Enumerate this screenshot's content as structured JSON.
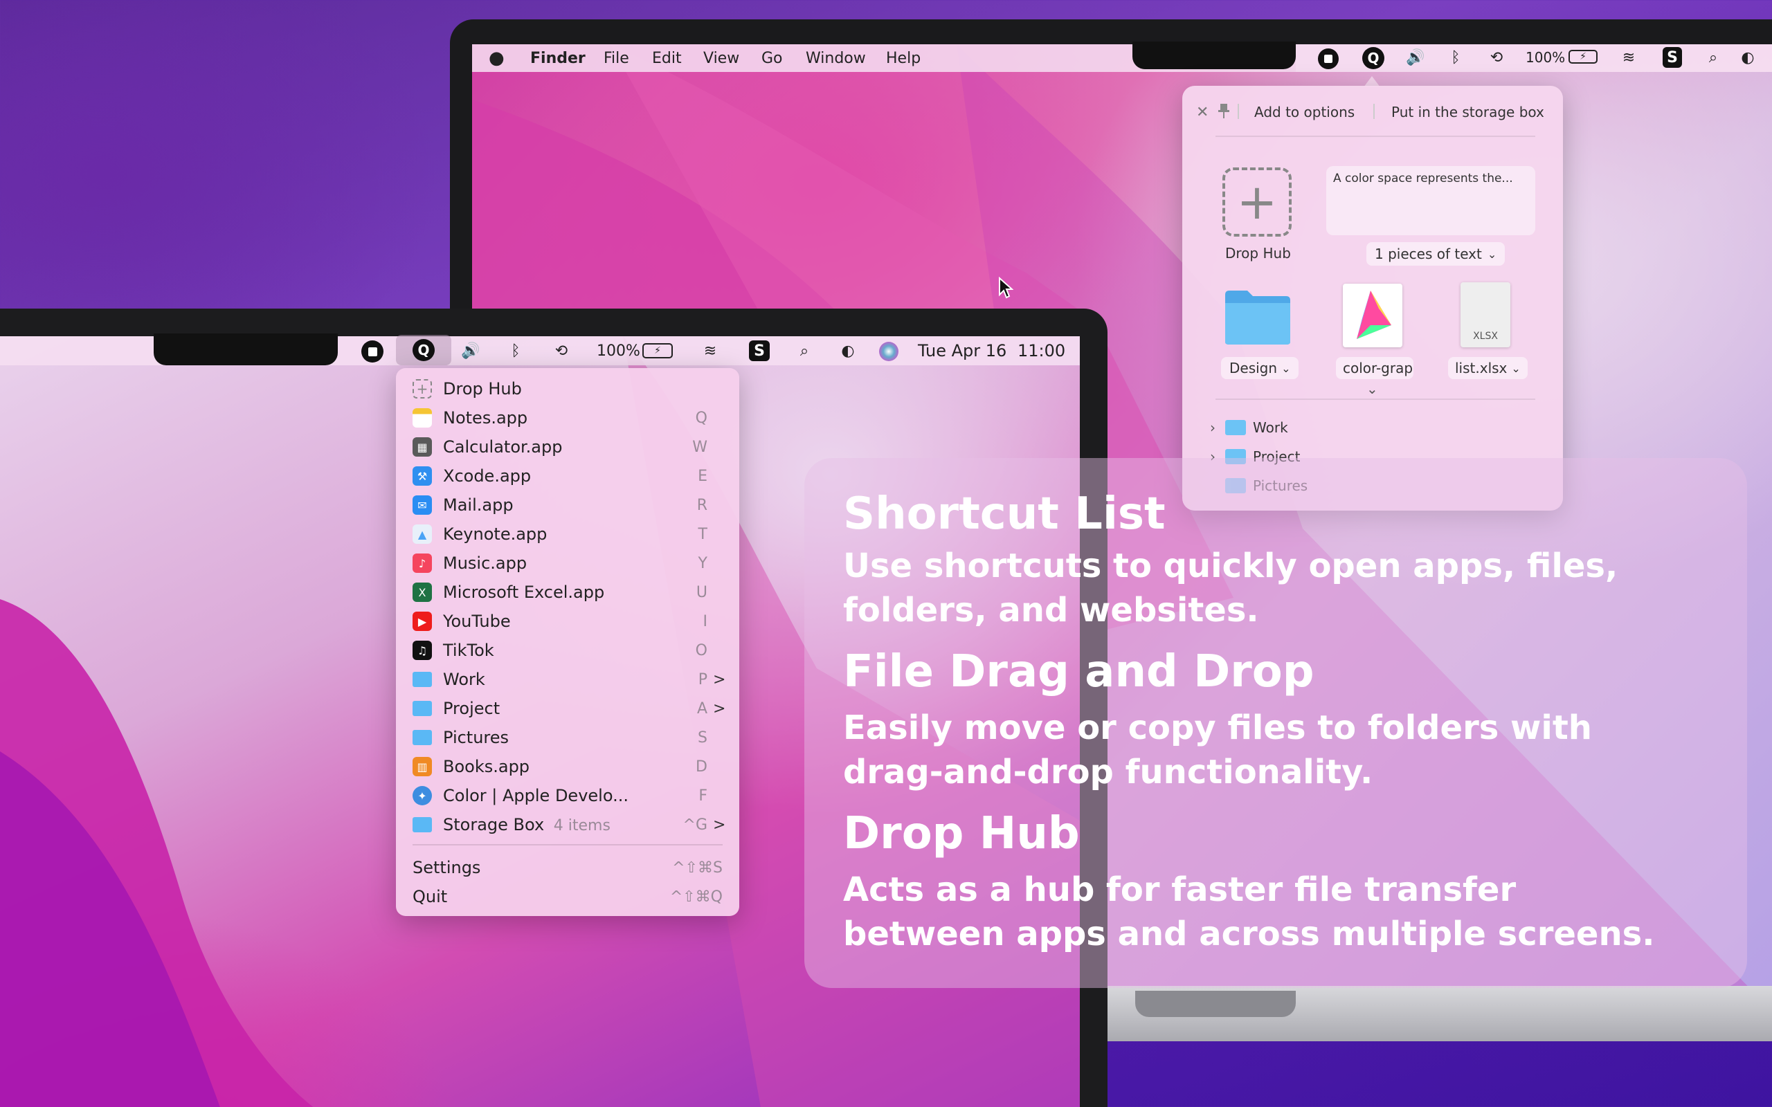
{
  "back_menubar": {
    "apple": "",
    "app": "Finder",
    "menus": [
      "File",
      "Edit",
      "View",
      "Go",
      "Window",
      "Help"
    ],
    "battery": "100%"
  },
  "front_menubar": {
    "battery": "100%",
    "date": "Tue Apr 16",
    "time": "11:00"
  },
  "menu": {
    "items": [
      {
        "label": "Drop Hub",
        "shortcut": "",
        "icon": "drop-hub-icon",
        "color": "#ffffff"
      },
      {
        "label": "Notes.app",
        "shortcut": "Q",
        "icon": "notes-icon",
        "color": "#f5c534"
      },
      {
        "label": "Calculator.app",
        "shortcut": "W",
        "icon": "calculator-icon",
        "color": "#5a5a5a"
      },
      {
        "label": "Xcode.app",
        "shortcut": "E",
        "icon": "xcode-icon",
        "color": "#2f8ff0"
      },
      {
        "label": "Mail.app",
        "shortcut": "R",
        "icon": "mail-icon",
        "color": "#2a8df3"
      },
      {
        "label": "Keynote.app",
        "shortcut": "T",
        "icon": "keynote-icon",
        "color": "#4aa3f5"
      },
      {
        "label": "Music.app",
        "shortcut": "Y",
        "icon": "music-icon",
        "color": "#f5455e"
      },
      {
        "label": "Microsoft Excel.app",
        "shortcut": "U",
        "icon": "excel-icon",
        "color": "#1f7244"
      },
      {
        "label": "YouTube",
        "shortcut": "I",
        "icon": "youtube-icon",
        "color": "#ee1c1c"
      },
      {
        "label": "TikTok",
        "shortcut": "O",
        "icon": "tiktok-icon",
        "color": "#111111"
      },
      {
        "label": "Work",
        "shortcut": "P",
        "icon": "folder-icon",
        "color": "#5ab8f5",
        "submenu": ">"
      },
      {
        "label": "Project",
        "shortcut": "A",
        "icon": "folder-icon",
        "color": "#5ab8f5",
        "submenu": ">"
      },
      {
        "label": "Pictures",
        "shortcut": "S",
        "icon": "pictures-folder-icon",
        "color": "#5ab8f5"
      },
      {
        "label": "Books.app",
        "shortcut": "D",
        "icon": "books-icon",
        "color": "#f08a24"
      },
      {
        "label": "Color | Apple Develo...",
        "shortcut": "F",
        "icon": "safari-icon",
        "color": "#3d8de0"
      },
      {
        "label": "Storage Box",
        "badge": "4 items",
        "shortcut": "^G",
        "icon": "folder-icon",
        "color": "#5ab8f5",
        "submenu": ">"
      }
    ],
    "settings": {
      "label": "Settings",
      "shortcut": "^⇧⌘S"
    },
    "quit": {
      "label": "Quit",
      "shortcut": "^⇧⌘Q"
    }
  },
  "panel": {
    "close": "✕",
    "add_options": "Add to options",
    "storage_box": "Put in the storage box",
    "drop_hub": "Drop Hub",
    "text_preview": "A color space represents the...",
    "pieces": "1 pieces of text",
    "files": [
      {
        "label": "Design"
      },
      {
        "label": "color-grap"
      },
      {
        "label": "list.xlsx"
      }
    ],
    "xlsx_tag": "XLSX",
    "folders": [
      "Work",
      "Project",
      "Pictures"
    ]
  },
  "overlay": {
    "h1": "Shortcut List",
    "p1a": "Use shortcuts to quickly open apps, files,",
    "p1b": "folders, and websites.",
    "h2": "File Drag and Drop",
    "p2a": "Easily move or copy files to folders with",
    "p2b": "drag-and-drop functionality.",
    "h3": "Drop Hub",
    "p3a": "Acts as a hub for faster file transfer",
    "p3b": "between apps and across multiple screens."
  }
}
